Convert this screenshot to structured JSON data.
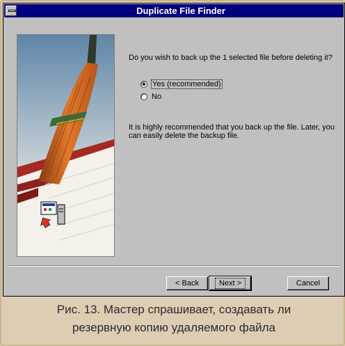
{
  "window": {
    "title": "Duplicate File Finder",
    "question": "Do you wish to back up the 1 selected file before deleting it?",
    "options": [
      {
        "label": "Yes (recommended)",
        "selected": true
      },
      {
        "label": "No",
        "selected": false
      }
    ],
    "note": "It is highly recommended that you back up the file.  Later, you can easily delete the backup file.",
    "buttons": {
      "back": "< Back",
      "next": "Next >",
      "cancel": "Cancel"
    }
  },
  "caption": {
    "line1": "Рис. 13. Мастер спрашивает, создавать ли",
    "line2": "резервную копию удаляемого файла"
  },
  "colors": {
    "titlebar": "#000080",
    "face": "#c0c0c0",
    "page": "#dccdb3"
  }
}
